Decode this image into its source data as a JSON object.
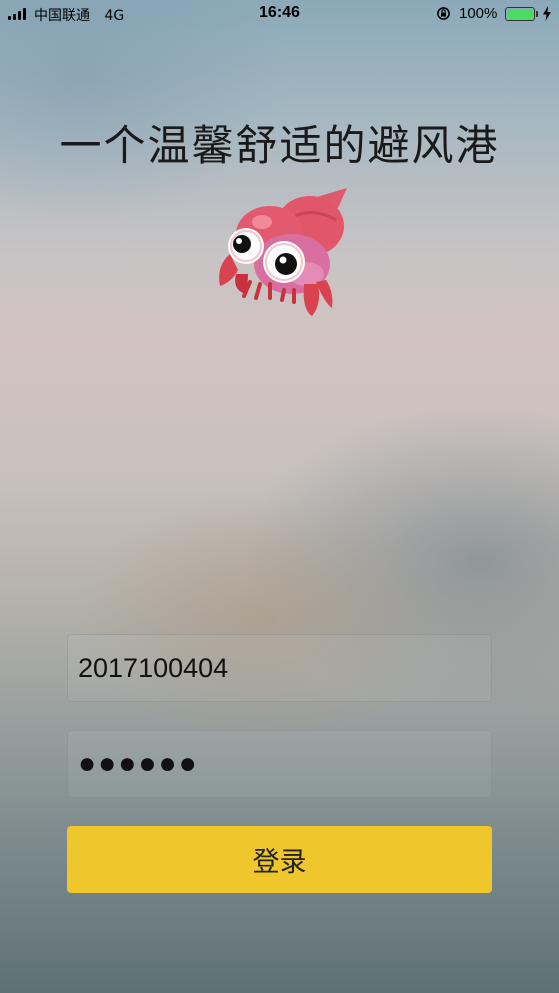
{
  "status_bar": {
    "carrier": "中国联通",
    "network": "4G",
    "time": "16:46",
    "battery_percent": "100%",
    "battery_level": 1.0,
    "signal_bars": 4
  },
  "title": "一个温馨舒适的避风港",
  "mascot": {
    "icon": "hermit-crab-icon"
  },
  "login": {
    "username_value": "2017100404",
    "password_value": "●●●●●●",
    "submit_label": "登录"
  },
  "colors": {
    "button": "#efc72c",
    "battery": "#4cd964"
  }
}
